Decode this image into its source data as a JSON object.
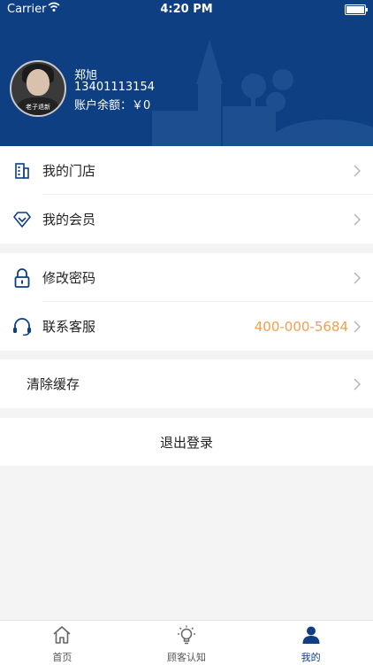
{
  "status_bar": {
    "carrier": "Carrier",
    "time": "4:20 PM"
  },
  "profile": {
    "avatar_caption": "老子退新",
    "name": "郑旭",
    "phone": "13401113154",
    "balance": "账户余额：￥0"
  },
  "menu": {
    "store": {
      "label": "我的门店"
    },
    "member": {
      "label": "我的会员"
    },
    "password": {
      "label": "修改密码"
    },
    "service": {
      "label": "联系客服",
      "value": "400-000-5684"
    },
    "cache": {
      "label": "清除缓存"
    }
  },
  "logout": {
    "label": "退出登录"
  },
  "tabbar": {
    "tabs": [
      {
        "label": "首页",
        "icon": "home-icon"
      },
      {
        "label": "顾客认知",
        "icon": "lightbulb-icon"
      },
      {
        "label": "我的",
        "icon": "user-icon"
      }
    ],
    "active_index": 2
  },
  "colors": {
    "primary": "#0d3f82",
    "accent": "#f0a04b"
  }
}
